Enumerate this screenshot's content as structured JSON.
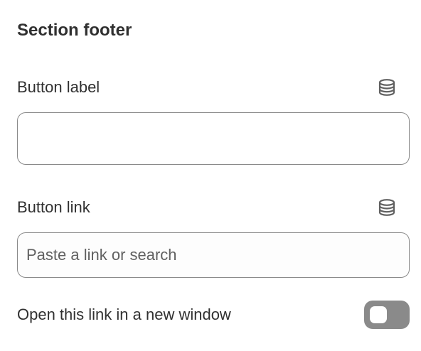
{
  "section": {
    "title": "Section footer"
  },
  "fields": {
    "button_label": {
      "label": "Button label",
      "value": "",
      "placeholder": "",
      "icon": "database-icon"
    },
    "button_link": {
      "label": "Button link",
      "value": "",
      "placeholder": "Paste a link or search",
      "icon": "database-icon"
    }
  },
  "new_window_toggle": {
    "label": "Open this link in a new window",
    "checked": false
  },
  "colors": {
    "text": "#303030",
    "border": "#8a8a8a",
    "toggle_off": "#8a8a8a",
    "placeholder": "#616161"
  }
}
